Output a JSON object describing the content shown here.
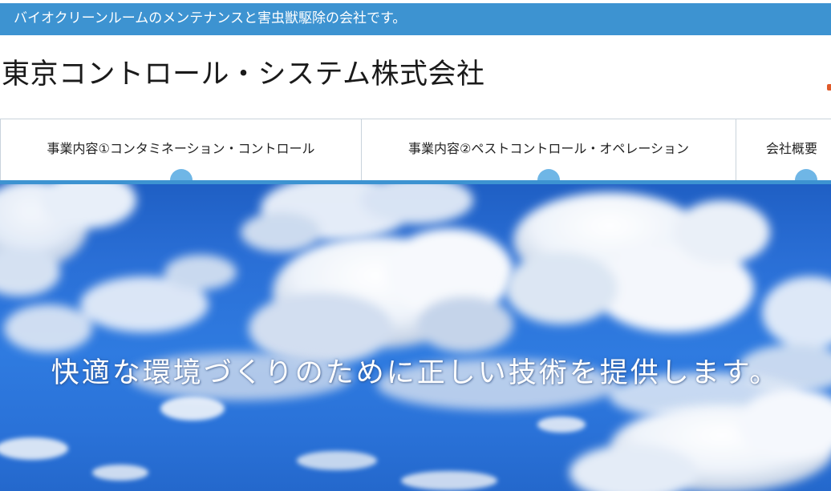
{
  "tagline": "バイオクリーンルームのメンテナンスと害虫獣駆除の会社です。",
  "site_title": "東京コントロール・システム株式会社",
  "nav": {
    "items": [
      {
        "label": "事業内容①コンタミネーション・コントロール"
      },
      {
        "label": "事業内容②ペストコントロール・オペレーション"
      },
      {
        "label": "会社概要"
      }
    ]
  },
  "hero": {
    "headline": "快適な環境づくりのために正しい技術を提供します。",
    "image": "blue-sky-with-clouds"
  },
  "colors": {
    "accent": "#3d93d1",
    "tab_marker": "#6fb6e6",
    "sky": "#2a6fd6"
  }
}
